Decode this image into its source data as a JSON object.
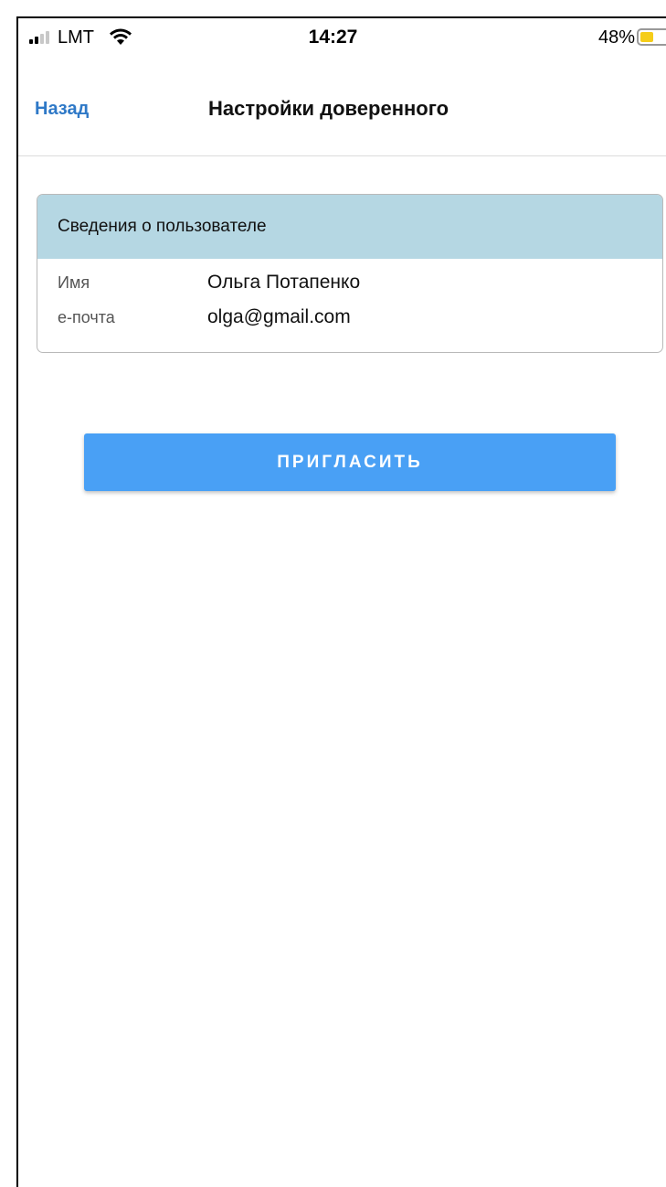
{
  "status_bar": {
    "carrier": "LMT",
    "time": "14:27",
    "battery_percent": "48%",
    "battery_level": 0.48,
    "battery_color": "#f5cd19",
    "signal_icon": "signal-bars-icon",
    "wifi_icon": "wifi-icon",
    "battery_icon": "battery-icon"
  },
  "nav": {
    "back_label": "Назад",
    "title": "Настройки доверенного"
  },
  "user_card": {
    "header": "Сведения о пользователе",
    "header_color": "#b5d7e3",
    "rows": [
      {
        "label": "Имя",
        "value": "Ольга Потапенко"
      },
      {
        "label": "е-почта",
        "value": "olga@gmail.com"
      }
    ]
  },
  "invite_button": {
    "label": "ПРИГЛАСИТЬ",
    "color": "#49a0f5"
  },
  "colors": {
    "accent": "#2f79c7"
  }
}
